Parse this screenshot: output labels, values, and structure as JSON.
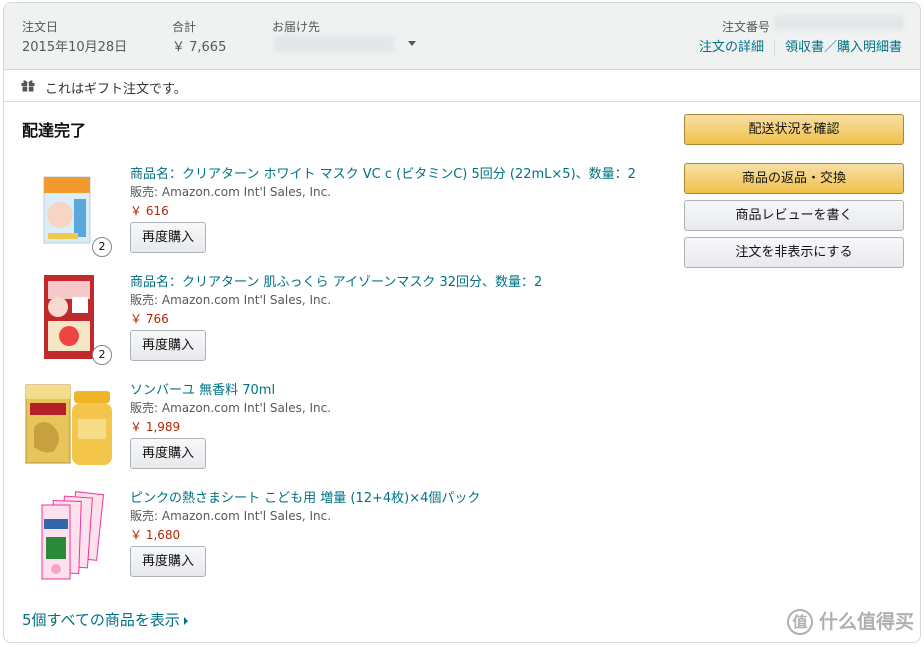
{
  "header": {
    "order_date_label": "注文日",
    "order_date": "2015年10月28日",
    "total_label": "合計",
    "total": "￥ 7,665",
    "ship_to_label": "お届け先",
    "order_number_label": "注文番号",
    "order_details_link": "注文の詳細",
    "receipt_link": "領収書／購入明細書"
  },
  "gift_note": "これはギフト注文です。",
  "status": "配達完了",
  "items": [
    {
      "title": "商品名：クリアターン ホワイト マスク VC c (ビタミンC) 5回分 (22mL×5)、数量：2",
      "seller": "販売: Amazon.com Int'l Sales, Inc.",
      "price": "￥ 616",
      "qty": "2",
      "rebuy": "再度購入"
    },
    {
      "title": "商品名：クリアターン 肌ふっくら アイゾーンマスク 32回分、数量：2",
      "seller": "販売: Amazon.com Int'l Sales, Inc.",
      "price": "￥ 766",
      "qty": "2",
      "rebuy": "再度購入"
    },
    {
      "title": "ソンバーユ 無香料 70ml",
      "seller": "販売: Amazon.com Int'l Sales, Inc.",
      "price": "￥ 1,989",
      "rebuy": "再度購入"
    },
    {
      "title": "ピンクの熱さまシート こども用 増量 (12+4枚)×4個パック",
      "seller": "販売: Amazon.com Int'l Sales, Inc.",
      "price": "￥ 1,680",
      "rebuy": "再度購入"
    }
  ],
  "actions": {
    "track": "配送状況を確認",
    "return": "商品の返品・交換",
    "review": "商品レビューを書く",
    "hide": "注文を非表示にする"
  },
  "show_all": "5個すべての商品を表示",
  "watermark": "什么值得买",
  "watermark_glyph": "值",
  "colors": {
    "link": "#007185",
    "price": "#b12704",
    "button_yellow": "#f0c14b"
  }
}
